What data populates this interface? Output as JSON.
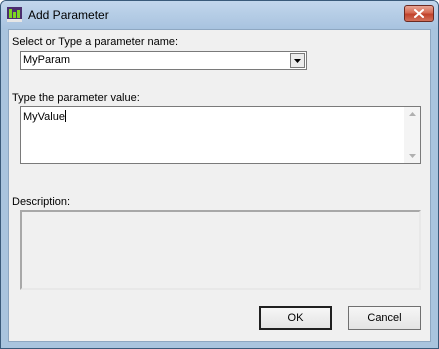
{
  "window": {
    "title": "Add Parameter"
  },
  "form": {
    "name_label": "Select or Type a parameter name:",
    "name_value": "MyParam",
    "value_label": "Type the parameter value:",
    "value_text": "MyValue",
    "description_label": "Description:",
    "description_text": ""
  },
  "buttons": {
    "ok_label": "OK",
    "cancel_label": "Cancel"
  },
  "icons": {
    "app": "app-icon",
    "close": "close-icon",
    "dropdown": "chevron-down-icon",
    "scroll_up": "scroll-up-arrow-icon",
    "scroll_down": "scroll-down-arrow-icon"
  }
}
